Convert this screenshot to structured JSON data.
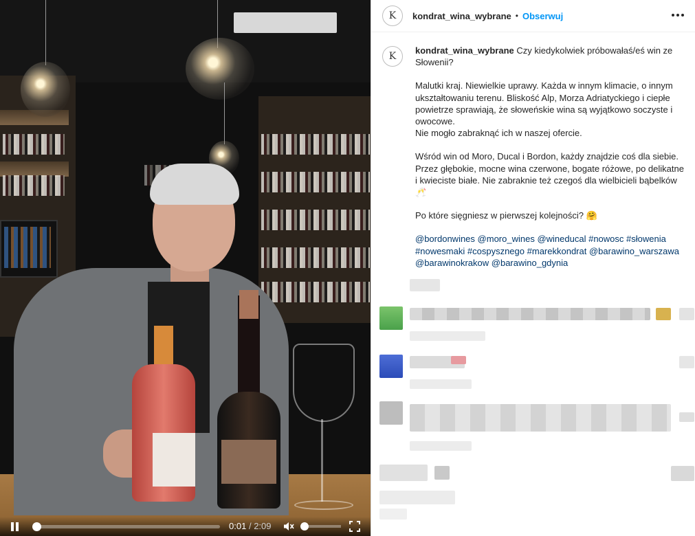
{
  "post": {
    "username": "kondrat_wina_wybrane",
    "separator": "•",
    "follow_label": "Obserwuj",
    "avatar_letter": "K"
  },
  "caption": {
    "username": "kondrat_wina_wybrane",
    "line1": "Czy kiedykolwiek próbowałaś/eś win ze Słowenii?",
    "para2": "Malutki kraj. Niewielkie uprawy. Każda w innym klimacie, o innym ukształtowaniu terenu. Bliskość Alp, Morza Adriatyckiego i ciepłe powietrze sprawiają, że słoweńskie wina są wyjątkowo soczyste i owocowe.",
    "para2b": "Nie mogło zabraknąć ich w naszej ofercie.",
    "para3": "Wśród win od Moro, Ducal i Bordon, każdy znajdzie coś dla siebie. Przez głębokie, mocne wina czerwone, bogate różowe, po delikatne i kwieciste białe. Nie zabraknie też czegoś dla wielbicieli bąbelków",
    "para4": "Po które sięgniesz w pierwszej kolejności?",
    "hashtags": [
      "@bordonwines",
      "@moro_wines",
      "@wineducal",
      "#nowosc",
      "#słowenia",
      "#nowesmaki",
      "#cospysznego",
      "#marekkondrat",
      "@barawino_warszawa",
      "@barawinokrakow",
      "@barawino_gdynia"
    ],
    "emoji_clink": "🥂",
    "emoji_hug": "🤗"
  },
  "video": {
    "current_time": "0:01",
    "time_separator": "/",
    "duration": "2:09",
    "progress": 0.02,
    "volume": 0.05
  },
  "colors": {
    "accent": "#0095f6",
    "link": "#00376b"
  }
}
